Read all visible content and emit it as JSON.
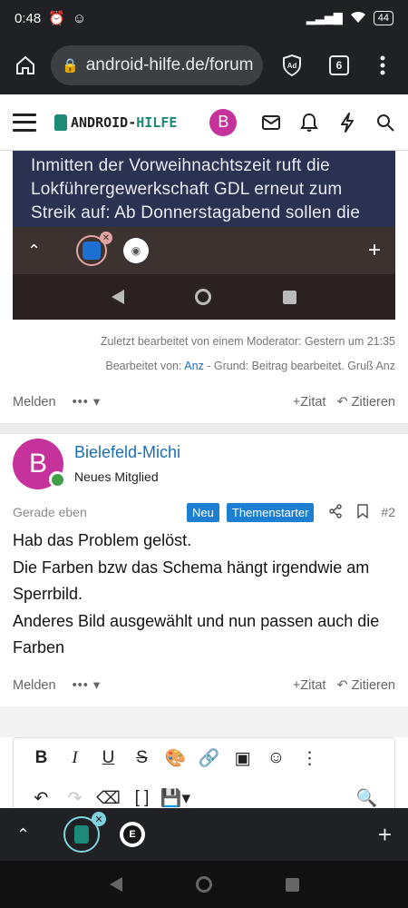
{
  "status": {
    "time": "0:48",
    "battery": "44"
  },
  "browser": {
    "url": "android-hilfe.de/forum",
    "tab_count": "6"
  },
  "site": {
    "logo_prefix": "ANDROID-",
    "logo_accent": "HILFE",
    "avatar_letter": "B"
  },
  "embed": {
    "article_text": "Inmitten der Vorweihnachtszeit ruft die Lokführergewerkschaft GDL erneut zum Streik auf: Ab Donnerstagabend sollen die"
  },
  "post1": {
    "edit_note": "Zuletzt bearbeitet von einem Moderator: Gestern um 21:35",
    "edited_by_prefix": "Bearbeitet von: ",
    "edited_by_user": "Anz",
    "edited_by_suffix": " - Grund: Beitrag bearbeitet. Gruß Anz",
    "report_label": "Melden",
    "quote_label": "Zitat",
    "cite_label": "Zitieren"
  },
  "post2": {
    "author_letter": "B",
    "author_name": "Bielefeld-Michi",
    "author_role": "Neues Mitglied",
    "timestamp": "Gerade eben",
    "badge_new": "Neu",
    "badge_starter": "Themenstarter",
    "post_number": "#2",
    "lines": [
      "Hab das Problem gelöst.",
      "Die Farben bzw das Schema hängt irgendwie am Sperrbild.",
      "Anderes Bild ausgewählt und nun passen auch die Farben"
    ],
    "report_label": "Melden",
    "quote_label": "Zitat",
    "cite_label": "Zitieren"
  },
  "editor": {
    "bold": "B",
    "italic": "I",
    "underline": "U",
    "strike": "S"
  },
  "bottom_tabs": {
    "tab2_letter": "E"
  },
  "colors": {
    "accent": "#1c7fd1",
    "avatar": "#c6329b",
    "brand": "#1d8a78",
    "online": "#3fa046"
  }
}
